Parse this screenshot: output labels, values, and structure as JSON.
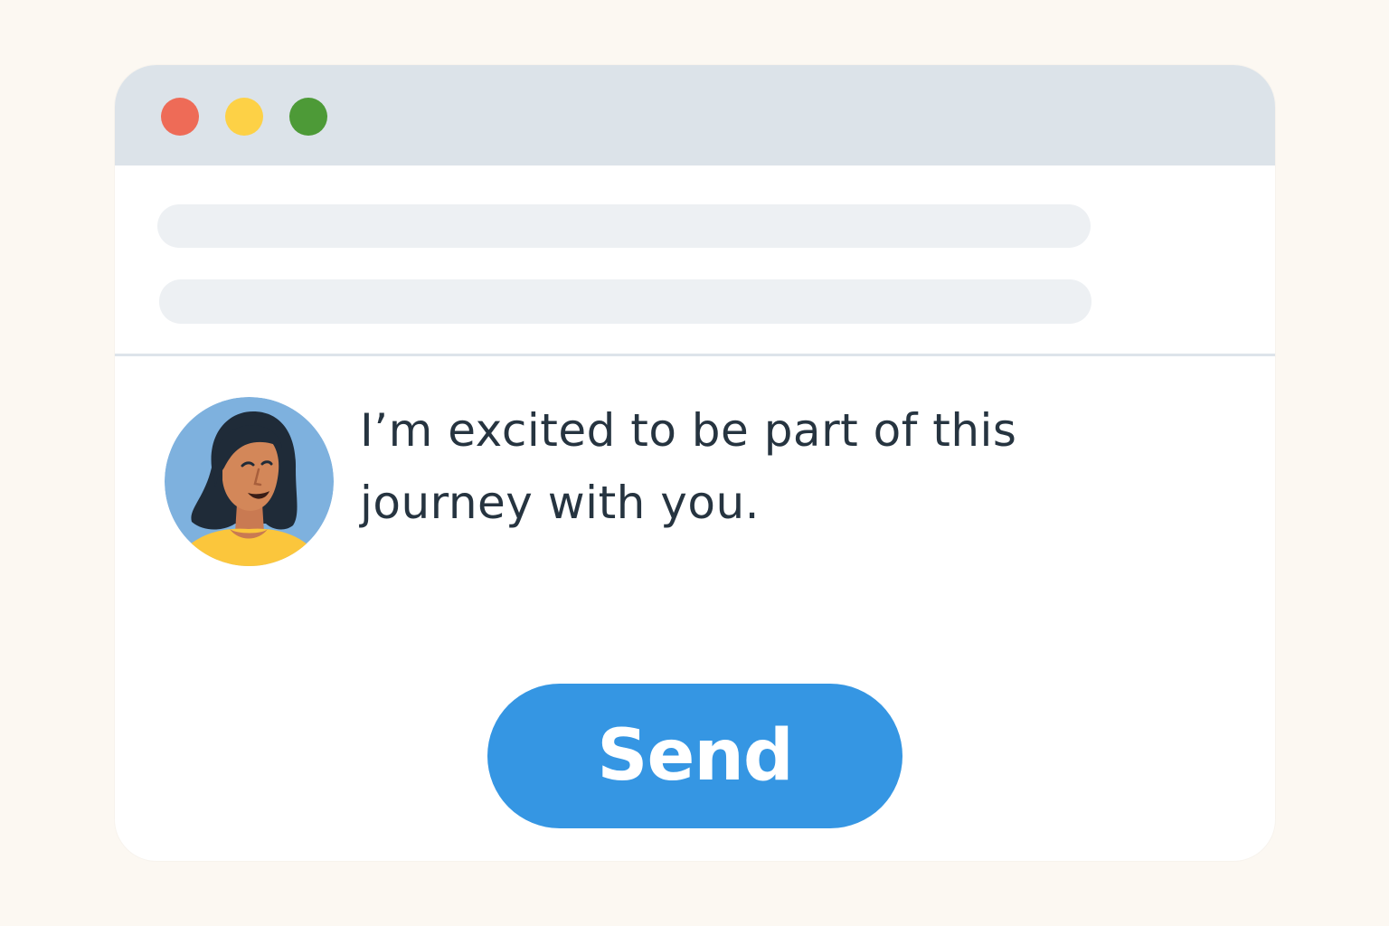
{
  "window": {
    "controls": [
      {
        "name": "close",
        "color": "#ee6b57"
      },
      {
        "name": "minimize",
        "color": "#fdd146"
      },
      {
        "name": "maximize",
        "color": "#4d9a37"
      }
    ]
  },
  "form": {
    "field_1_value": "",
    "field_2_value": ""
  },
  "message": {
    "avatar_icon": "user-avatar-woman",
    "text": "I’m excited to be part of this journey with you."
  },
  "actions": {
    "send_label": "Send",
    "send_color": "#3596e3"
  }
}
